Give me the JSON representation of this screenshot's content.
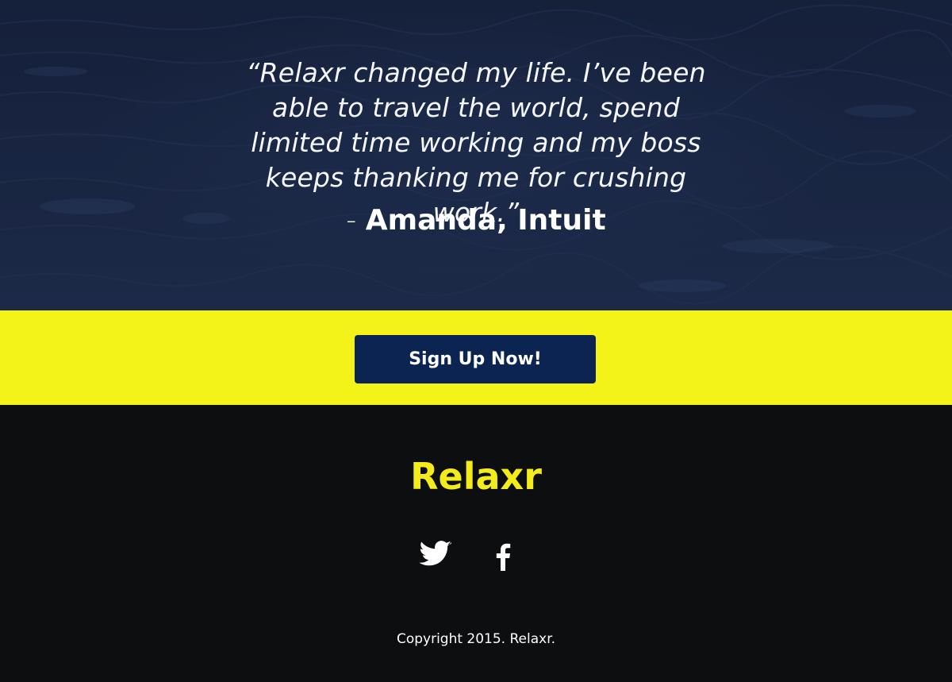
{
  "testimonial": {
    "quote": "“Relaxr changed my life. I’ve been able to travel the world, spend limited time working and my boss keeps thanking me for crushing work.”",
    "dash": "- ",
    "author": "Amanda, Intuit"
  },
  "cta": {
    "signup_label": "Sign Up Now!"
  },
  "footer": {
    "brand": "Relaxr",
    "social": [
      {
        "icon": "twitter-icon"
      },
      {
        "icon": "facebook-icon"
      }
    ],
    "copyright": "Copyright 2015. Relaxr."
  },
  "colors": {
    "accent_yellow": "#f3f31a",
    "button_navy": "#0b2452",
    "footer_bg": "#0d0e10",
    "brand_yellow": "#f4ec1a"
  }
}
